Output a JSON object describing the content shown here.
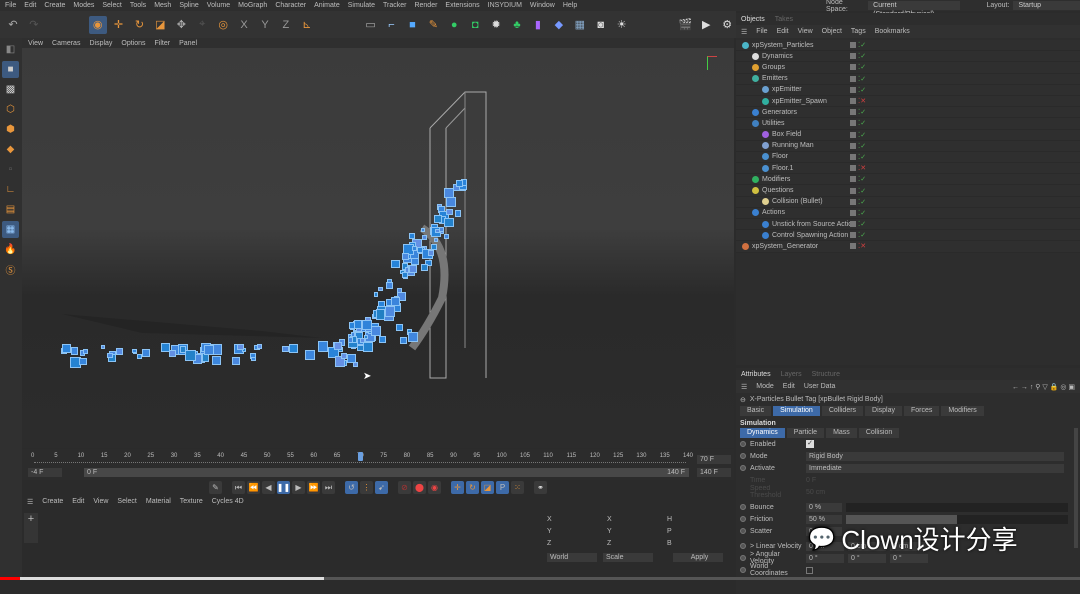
{
  "menu": [
    "File",
    "Edit",
    "Create",
    "Modes",
    "Select",
    "Tools",
    "Mesh",
    "Spline",
    "Volume",
    "MoGraph",
    "Character",
    "Animate",
    "Simulate",
    "Tracker",
    "Render",
    "Extensions",
    "INSYDIUM",
    "Window",
    "Help"
  ],
  "node_space": {
    "label": "Node Space:",
    "value": "Current (Standard/Physical)"
  },
  "layout": {
    "label": "Layout:",
    "value": "Startup"
  },
  "viewport_menu": [
    "View",
    "Cameras",
    "Display",
    "Options",
    "Filter",
    "Panel"
  ],
  "objects": {
    "tabs": [
      "Objects",
      "Takes"
    ],
    "menu": [
      "File",
      "Edit",
      "View",
      "Object",
      "Tags",
      "Bookmarks"
    ],
    "items": [
      {
        "name": "xpSystem_Particles",
        "depth": 0,
        "color": "#4bb6c8",
        "ok": true
      },
      {
        "name": "Dynamics",
        "depth": 1,
        "color": "#dddddd",
        "ok": true
      },
      {
        "name": "Groups",
        "depth": 1,
        "color": "#e0a030",
        "ok": true
      },
      {
        "name": "Emitters",
        "depth": 1,
        "color": "#40b0a0",
        "ok": true
      },
      {
        "name": "xpEmitter",
        "depth": 2,
        "color": "#6aa0d0",
        "ok": true
      },
      {
        "name": "xpEmitter_Spawn",
        "depth": 2,
        "color": "#30b0a0",
        "ok": false
      },
      {
        "name": "Generators",
        "depth": 1,
        "color": "#3a80d0",
        "ok": true
      },
      {
        "name": "Utilities",
        "depth": 1,
        "color": "#4080c0",
        "ok": true
      },
      {
        "name": "Box Field",
        "depth": 2,
        "color": "#a060e0",
        "ok": true
      },
      {
        "name": "Running Man",
        "depth": 2,
        "color": "#80a0d0",
        "ok": true
      },
      {
        "name": "Floor",
        "depth": 2,
        "color": "#4a90d0",
        "ok": true
      },
      {
        "name": "Floor.1",
        "depth": 2,
        "color": "#4a90d0",
        "ok": false
      },
      {
        "name": "Modifiers",
        "depth": 1,
        "color": "#30b060",
        "ok": true
      },
      {
        "name": "Questions",
        "depth": 1,
        "color": "#d0c040",
        "ok": true
      },
      {
        "name": "Collision (Bullet)",
        "depth": 2,
        "color": "#e0d090",
        "ok": true
      },
      {
        "name": "Actions",
        "depth": 1,
        "color": "#3a80d0",
        "ok": true
      },
      {
        "name": "Unstick from Source Action",
        "depth": 2,
        "color": "#3a80d0",
        "ok": true
      },
      {
        "name": "Control Spawning Action",
        "depth": 2,
        "color": "#3a80d0",
        "ok": true
      },
      {
        "name": "xpSystem_Generator",
        "depth": 0,
        "color": "#d07040",
        "ok": false
      }
    ]
  },
  "attributes": {
    "tabs": [
      "Attributes",
      "Layers",
      "Structure"
    ],
    "menu": [
      "Mode",
      "Edit",
      "User Data"
    ],
    "title": "X-Particles Bullet Tag [xpBullet Rigid Body]",
    "main_tabs": [
      "Basic",
      "Simulation",
      "Colliders",
      "Display",
      "Forces",
      "Modifiers"
    ],
    "section": "Simulation",
    "sub_tabs": [
      "Dynamics",
      "Particle",
      "Mass",
      "Collision"
    ],
    "enabled_label": "Enabled",
    "mode_label": "Mode",
    "mode_value": "Rigid Body",
    "activate_label": "Activate",
    "activate_value": "Immediate",
    "time_label": "Time",
    "time_value": "0 F",
    "speed_label": "Speed Threshold",
    "speed_value": "50 cm",
    "bounce_label": "Bounce",
    "bounce_value": "0 %",
    "bounce_fraction": 0,
    "friction_label": "Friction",
    "friction_value": "50 %",
    "friction_fraction": 0.5,
    "scatter_label": "Scatter",
    "scatter_value": "0 %",
    "linvel_label": "> Linear Velocity",
    "linvel": [
      "0 cm",
      "0 cm",
      "0 cm"
    ],
    "angvel_label": "> Angular Velocity",
    "angvel": [
      "0 °",
      "0 °",
      "0 °"
    ],
    "world_label": "World Coordinates"
  },
  "timeline": {
    "ticks": [
      "0",
      "5",
      "10",
      "15",
      "20",
      "25",
      "30",
      "35",
      "40",
      "45",
      "50",
      "55",
      "60",
      "65",
      "70",
      "75",
      "80",
      "85",
      "90",
      "95",
      "100",
      "105",
      "110",
      "115",
      "120",
      "125",
      "130",
      "135",
      "140"
    ],
    "current_frame": 70,
    "current_label": "70 F",
    "start": "-4 F",
    "range_start": "0 F",
    "range_end": "140 F",
    "end": "140 F"
  },
  "material_menu": [
    "Create",
    "Edit",
    "View",
    "Select",
    "Material",
    "Texture",
    "Cycles 4D"
  ],
  "coords": {
    "rows": [
      [
        "X",
        "X",
        "H"
      ],
      [
        "Y",
        "Y",
        "P"
      ],
      [
        "Z",
        "Z",
        "B"
      ]
    ],
    "mode1": "World",
    "mode2": "Scale",
    "apply": "Apply"
  },
  "watermark": "Clown设计分享",
  "video_progress": 0.3
}
